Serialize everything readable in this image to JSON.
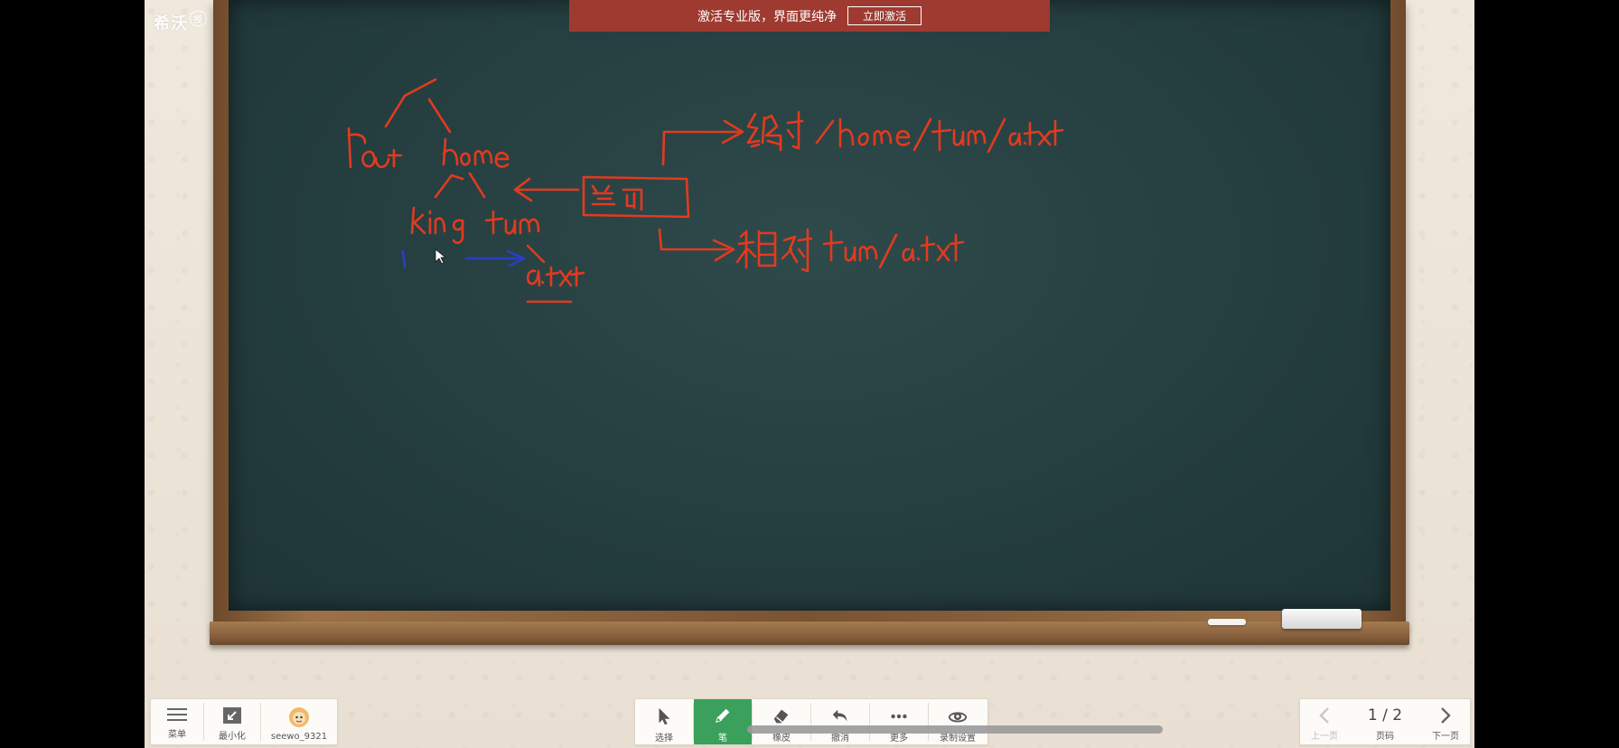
{
  "app": {
    "brand": "希沃",
    "brand_badge": "授"
  },
  "banner": {
    "text": "激活专业版，界面更纯净",
    "button": "立即激活"
  },
  "board_ink": {
    "tree": [
      "root",
      "home",
      "king",
      "tom",
      "a.txt"
    ],
    "current_box": "当前",
    "absolute": {
      "label": "绝对",
      "path": "/home/tom/a.txt"
    },
    "relative": {
      "label": "相对",
      "path": "tom/a.txt"
    }
  },
  "colors": {
    "ink_red": "#e33a1e",
    "ink_blue": "#2a3ec4",
    "active_tool": "#3aa05b",
    "banner": "#9e3a30"
  },
  "left_panel": {
    "menu": {
      "label": "菜单",
      "icon": "hamburger-icon"
    },
    "minimize": {
      "label": "最小化",
      "icon": "minimize-icon"
    },
    "user": {
      "label": "seewo_9321",
      "icon": "avatar-icon"
    }
  },
  "tools": [
    {
      "id": "select",
      "label": "选择",
      "icon": "cursor-icon"
    },
    {
      "id": "pen",
      "label": "笔",
      "icon": "pen-icon",
      "active": true
    },
    {
      "id": "eraser",
      "label": "橡皮",
      "icon": "eraser-icon"
    },
    {
      "id": "undo",
      "label": "撤消",
      "icon": "undo-icon"
    },
    {
      "id": "more",
      "label": "更多",
      "icon": "more-icon"
    },
    {
      "id": "record",
      "label": "录制设置",
      "icon": "record-icon"
    }
  ],
  "pager": {
    "prev": "上一页",
    "page_label": "页码",
    "next": "下一页",
    "current": "1 / 2"
  }
}
